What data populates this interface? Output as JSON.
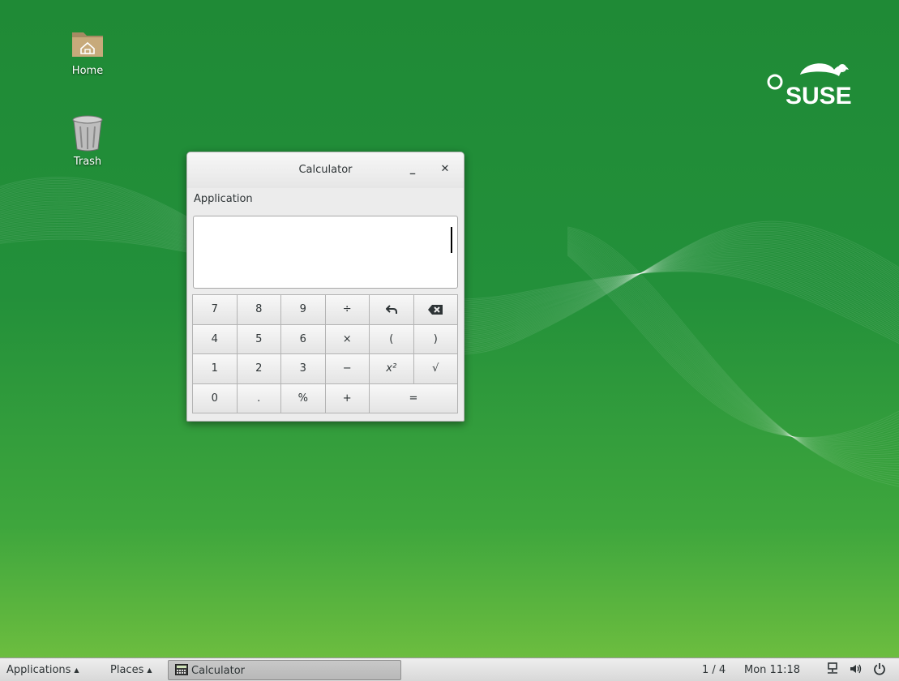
{
  "desktop": {
    "icons": [
      {
        "label": "Home"
      },
      {
        "label": "Trash"
      }
    ],
    "logo_text": "SUSE"
  },
  "calculator": {
    "title": "Calculator",
    "minimize_symbol": "_",
    "close_symbol": "✕",
    "menu_label": "Application",
    "display_value": "",
    "keys": [
      "7",
      "8",
      "9",
      "÷",
      "undo-icon",
      "backspace-icon",
      "4",
      "5",
      "6",
      "×",
      "(",
      ")",
      "1",
      "2",
      "3",
      "−",
      "x²",
      "√",
      "0",
      ".",
      "%",
      "+",
      "="
    ]
  },
  "panel": {
    "applications_label": "Applications",
    "places_label": "Places",
    "task_label": "Calculator",
    "workspace": "1 / 4",
    "clock": "Mon 11:18",
    "icons": [
      "network-icon",
      "volume-icon",
      "power-icon"
    ]
  },
  "colors": {
    "desktop_green": "#23903a",
    "desktop_light_green": "#6cbd3f",
    "panel_bg": "#e4e4e4"
  }
}
